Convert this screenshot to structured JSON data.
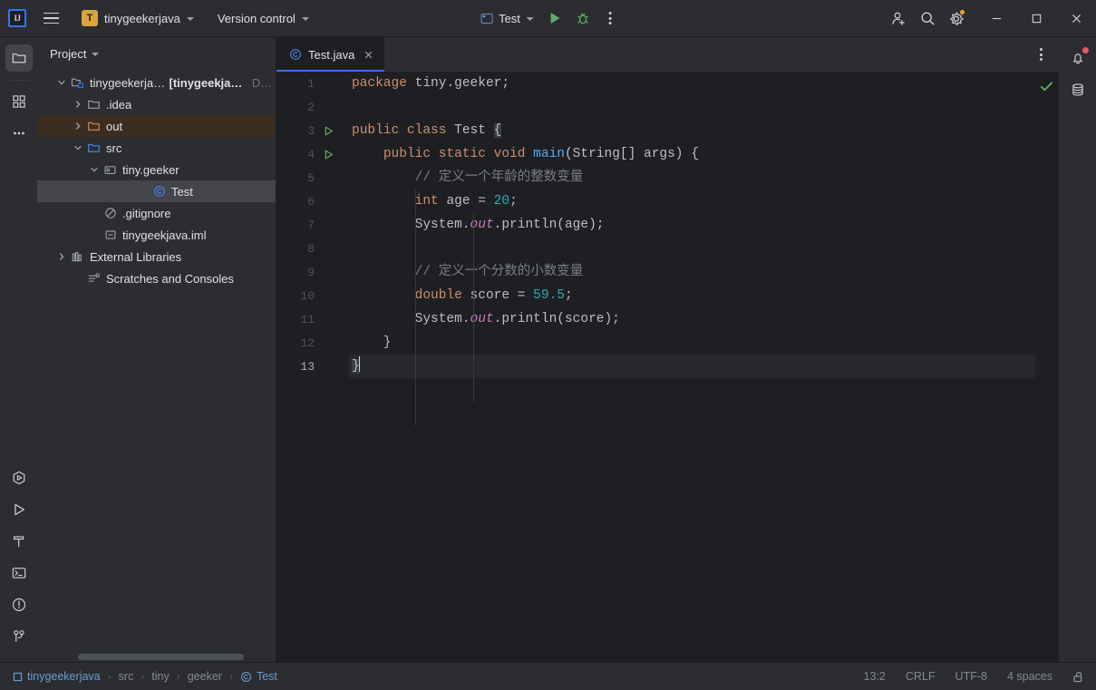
{
  "titlebar": {
    "logo_text": "IJ",
    "project_name": "tinygeekerjava",
    "project_badge": "T",
    "vcs_label": "Version control",
    "run_config": "Test",
    "icons": {
      "menu": "hamburger-icon",
      "run": "run-icon",
      "debug": "debug-icon",
      "more": "more-options-icon",
      "add_account": "add-account-icon",
      "search": "search-icon",
      "settings": "settings-gear-icon",
      "minimize": "minimize-icon",
      "maximize": "maximize-icon",
      "close": "close-icon"
    }
  },
  "left_toolstrip": [
    {
      "name": "project-tool-window",
      "icon": "folder-icon",
      "active": true
    },
    {
      "name": "structure-tool-window",
      "icon": "blocks-icon",
      "active": false
    },
    {
      "name": "more-tool-windows",
      "icon": "ellipsis-icon",
      "active": false
    }
  ],
  "left_toolstrip_bottom": [
    {
      "name": "services-tool-window",
      "icon": "services-icon"
    },
    {
      "name": "run-tool-window",
      "icon": "run-triangle-icon"
    },
    {
      "name": "build-tool-window",
      "icon": "hammer-icon"
    },
    {
      "name": "terminal-tool-window",
      "icon": "terminal-icon"
    },
    {
      "name": "problems-tool-window",
      "icon": "warning-circle-icon"
    },
    {
      "name": "version-control-tool-window",
      "icon": "branch-icon"
    }
  ],
  "right_toolstrip": [
    {
      "name": "notifications",
      "icon": "bell-icon",
      "badge": true
    },
    {
      "name": "database-tool-window",
      "icon": "database-icon",
      "badge": false
    }
  ],
  "project_panel": {
    "title": "Project",
    "tree": [
      {
        "label": "tinygeekerjava",
        "module": "[tinygeekjava]",
        "path": "D:\\t",
        "icon": "project-root-icon",
        "depth": 0,
        "arrow": "down",
        "bold_module": true
      },
      {
        "label": ".idea",
        "icon": "folder-icon",
        "depth": 1,
        "arrow": "right"
      },
      {
        "label": "out",
        "icon": "folder-excluded-icon",
        "depth": 1,
        "arrow": "right",
        "excluded": true
      },
      {
        "label": "src",
        "icon": "folder-source-icon",
        "depth": 1,
        "arrow": "down"
      },
      {
        "label": "tiny.geeker",
        "icon": "package-icon",
        "depth": 2,
        "arrow": "down"
      },
      {
        "label": "Test",
        "icon": "java-class-icon",
        "depth": 3,
        "arrow": "none",
        "selected": true
      },
      {
        "label": ".gitignore",
        "icon": "gitignore-icon",
        "depth": 1,
        "arrow": "none"
      },
      {
        "label": "tinygeekjava.iml",
        "icon": "iml-file-icon",
        "depth": 1,
        "arrow": "none"
      },
      {
        "label": "External Libraries",
        "icon": "libraries-icon",
        "depth": 0,
        "arrow": "right"
      },
      {
        "label": "Scratches and Consoles",
        "icon": "scratches-icon",
        "depth": 0,
        "arrow": "none"
      }
    ]
  },
  "editor": {
    "tab": {
      "label": "Test.java",
      "icon": "java-class-icon",
      "close": "close-icon"
    },
    "options_icon": "more-options-icon",
    "inspection_status": "ok-check-icon",
    "lines": [
      {
        "n": 1,
        "runmark": false,
        "tokens": [
          {
            "t": "package ",
            "c": "k"
          },
          {
            "t": "tiny.geeker;",
            "c": "pln"
          }
        ]
      },
      {
        "n": 2,
        "runmark": false,
        "tokens": []
      },
      {
        "n": 3,
        "runmark": true,
        "tokens": [
          {
            "t": "public ",
            "c": "k"
          },
          {
            "t": "class ",
            "c": "k"
          },
          {
            "t": "Test ",
            "c": "pln"
          },
          {
            "t": "{",
            "c": "brace"
          }
        ]
      },
      {
        "n": 4,
        "runmark": true,
        "tokens": [
          {
            "t": "    ",
            "c": "pln"
          },
          {
            "t": "public ",
            "c": "k"
          },
          {
            "t": "static ",
            "c": "k"
          },
          {
            "t": "void ",
            "c": "k"
          },
          {
            "t": "main",
            "c": "mth"
          },
          {
            "t": "(String[] args) {",
            "c": "pln"
          }
        ]
      },
      {
        "n": 5,
        "runmark": false,
        "tokens": [
          {
            "t": "        ",
            "c": "pln"
          },
          {
            "t": "// 定义一个年龄的整数变量",
            "c": "cmt"
          }
        ]
      },
      {
        "n": 6,
        "runmark": false,
        "tokens": [
          {
            "t": "        ",
            "c": "pln"
          },
          {
            "t": "int ",
            "c": "k"
          },
          {
            "t": "age = ",
            "c": "pln"
          },
          {
            "t": "20",
            "c": "num"
          },
          {
            "t": ";",
            "c": "pln"
          }
        ]
      },
      {
        "n": 7,
        "runmark": false,
        "tokens": [
          {
            "t": "        ",
            "c": "pln"
          },
          {
            "t": "System.",
            "c": "pln"
          },
          {
            "t": "out",
            "c": "fld"
          },
          {
            "t": ".println(age);",
            "c": "pln"
          }
        ]
      },
      {
        "n": 8,
        "runmark": false,
        "tokens": []
      },
      {
        "n": 9,
        "runmark": false,
        "tokens": [
          {
            "t": "        ",
            "c": "pln"
          },
          {
            "t": "// 定义一个分数的小数变量",
            "c": "cmt"
          }
        ]
      },
      {
        "n": 10,
        "runmark": false,
        "tokens": [
          {
            "t": "        ",
            "c": "pln"
          },
          {
            "t": "double ",
            "c": "k"
          },
          {
            "t": "score = ",
            "c": "pln"
          },
          {
            "t": "59.5",
            "c": "num"
          },
          {
            "t": ";",
            "c": "pln"
          }
        ]
      },
      {
        "n": 11,
        "runmark": false,
        "tokens": [
          {
            "t": "        ",
            "c": "pln"
          },
          {
            "t": "System.",
            "c": "pln"
          },
          {
            "t": "out",
            "c": "fld"
          },
          {
            "t": ".println(score);",
            "c": "pln"
          }
        ]
      },
      {
        "n": 12,
        "runmark": false,
        "tokens": [
          {
            "t": "    }",
            "c": "pln"
          }
        ]
      },
      {
        "n": 13,
        "runmark": false,
        "current": true,
        "caret": true,
        "tokens": [
          {
            "t": "}",
            "c": "brace"
          }
        ]
      }
    ]
  },
  "statusbar": {
    "breadcrumb": [
      {
        "label": "tinygeekerjava",
        "icon": "module-icon",
        "link": true
      },
      {
        "label": "src",
        "icon": "",
        "link": false
      },
      {
        "label": "tiny",
        "icon": "",
        "link": false
      },
      {
        "label": "geeker",
        "icon": "",
        "link": false
      },
      {
        "label": "Test",
        "icon": "java-class-icon",
        "link": true
      }
    ],
    "separator": "›",
    "caret_position": "13:2",
    "line_separator": "CRLF",
    "encoding": "UTF-8",
    "indent": "4 spaces",
    "lock_icon": "unlocked-icon"
  },
  "colors": {
    "accent_blue": "#3574f0",
    "keyword_orange": "#cf8e6d",
    "number_cyan": "#2aacb8",
    "comment_gray": "#7a7e85",
    "method_blue": "#56a8f5",
    "static_field": "#c77dbb",
    "excluded_folder": "#3b2e20",
    "panel_bg": "#2b2d30",
    "editor_bg": "#1e1f22",
    "notification_red": "#e55765",
    "run_green": "#5fad65"
  }
}
